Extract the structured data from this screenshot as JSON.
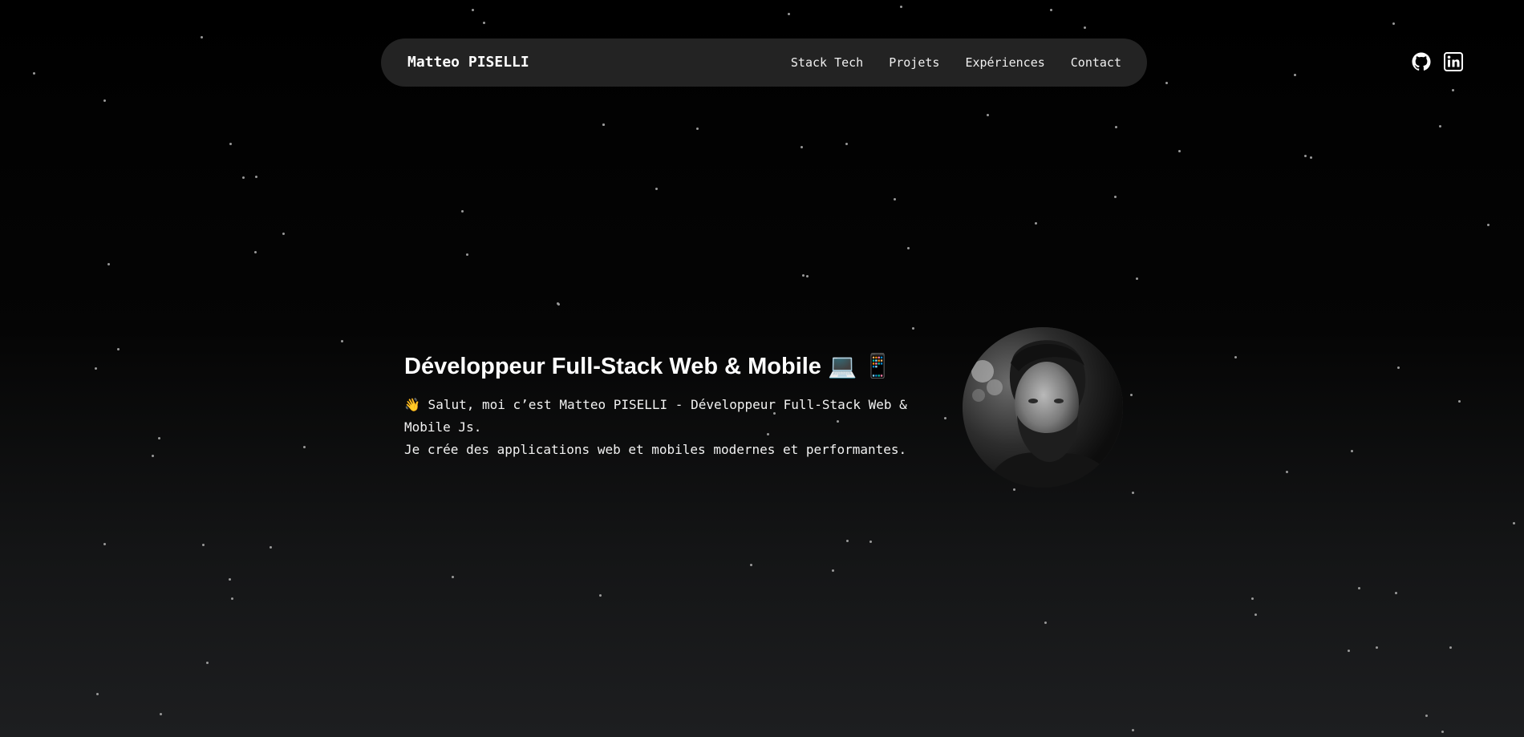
{
  "navbar": {
    "brand": "Matteo PISELLI",
    "links": [
      "Stack Tech",
      "Projets",
      "Expériences",
      "Contact"
    ]
  },
  "socials": {
    "icons": [
      "github-icon",
      "linkedin-icon"
    ]
  },
  "hero": {
    "title": "Développeur Full-Stack Web & Mobile 💻 📱",
    "intro_line": "👋 Salut, moi c’est Matteo PISELLI - Développeur Full-Stack Web & Mobile Js.",
    "second_line": "Je crée des applications web et mobiles modernes et performantes."
  },
  "avatar": {
    "alt": "Matteo PISELLI"
  },
  "colors": {
    "background_top": "#000000",
    "background_bottom": "#1d1e20",
    "navbar_bg": "#232323",
    "text": "#ffffff",
    "star": "#9a9a9a"
  }
}
